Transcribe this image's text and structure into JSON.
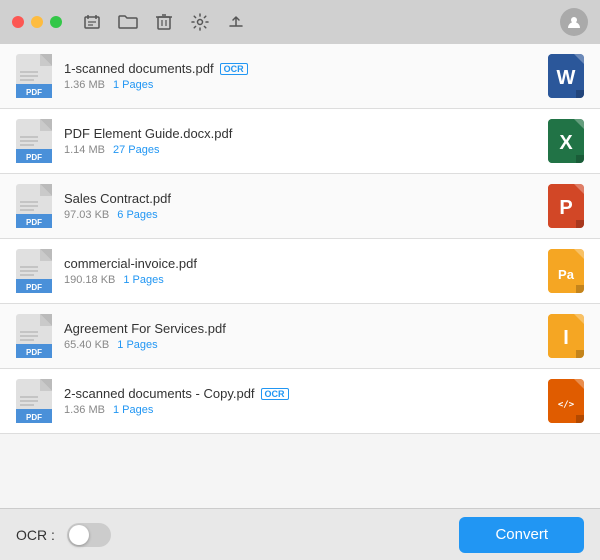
{
  "titlebar": {
    "traffic_lights": [
      "close",
      "minimize",
      "maximize"
    ]
  },
  "toolbar": {
    "icons": [
      "new-tab-icon",
      "folder-icon",
      "trash-icon",
      "settings-icon",
      "upload-icon"
    ],
    "user_icon": "👤"
  },
  "files": [
    {
      "id": 1,
      "name": "1-scanned documents.pdf",
      "has_ocr": true,
      "size": "1.36 MB",
      "pages": "1 Pages",
      "output_type": "word",
      "output_letter": "W",
      "output_color": "#2b579a"
    },
    {
      "id": 2,
      "name": "PDF Element Guide.docx.pdf",
      "has_ocr": false,
      "size": "1.14 MB",
      "pages": "27 Pages",
      "output_type": "excel",
      "output_letter": "X",
      "output_color": "#217346"
    },
    {
      "id": 3,
      "name": "Sales Contract.pdf",
      "has_ocr": false,
      "size": "97.03 KB",
      "pages": "6 Pages",
      "output_type": "ppt",
      "output_letter": "P",
      "output_color": "#d24726"
    },
    {
      "id": 4,
      "name": "commercial-invoice.pdf",
      "has_ocr": false,
      "size": "190.18 KB",
      "pages": "1 Pages",
      "output_type": "pdf2",
      "output_letter": "Pa",
      "output_color": "#f5a623"
    },
    {
      "id": 5,
      "name": "Agreement For Services.pdf",
      "has_ocr": false,
      "size": "65.40 KB",
      "pages": "1 Pages",
      "output_type": "indesign",
      "output_letter": "I",
      "output_color": "#f5a623"
    },
    {
      "id": 6,
      "name": "2-scanned documents - Copy.pdf",
      "has_ocr": true,
      "size": "1.36 MB",
      "pages": "1 Pages",
      "output_type": "code",
      "output_letter": "< />",
      "output_color": "#e05c00"
    }
  ],
  "bottom": {
    "ocr_label": "OCR :",
    "convert_label": "Convert"
  }
}
